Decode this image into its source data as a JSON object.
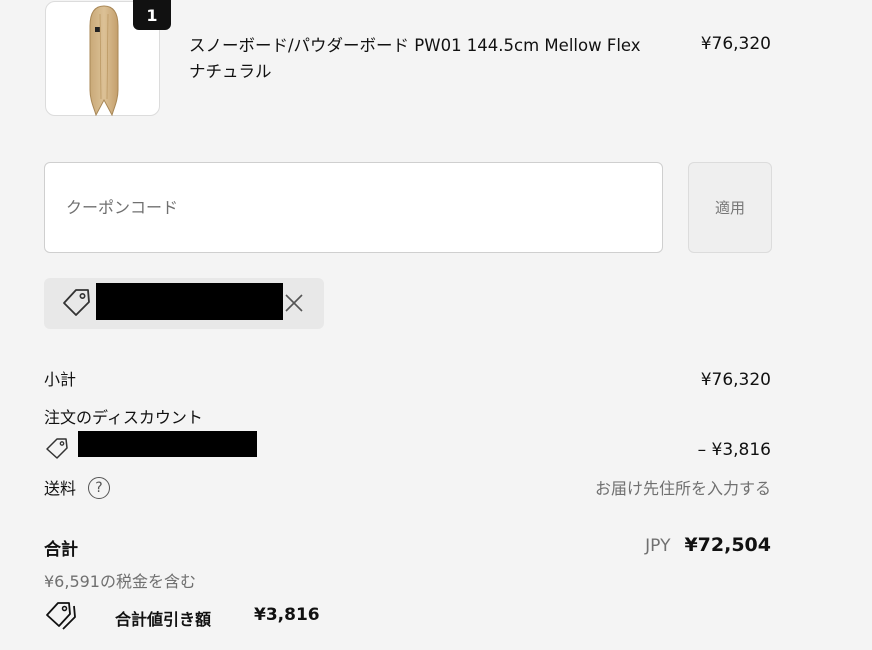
{
  "product": {
    "quantity": "1",
    "name_line1": "スノーボード/パウダーボード PW01 144.5cm Mellow Flex",
    "name_line2": "ナチュラル",
    "price": "¥76,320",
    "image_icon": "snowboard-icon"
  },
  "coupon": {
    "placeholder": "クーポンコード",
    "apply_label": "適用",
    "applied_icon": "tag-icon",
    "remove_icon": "close-icon"
  },
  "summary": {
    "subtotal_label": "小計",
    "subtotal_value": "¥76,320",
    "discount_label": "注文のディスカウント",
    "discount_value": "– ¥3,816",
    "shipping_label": "送料",
    "shipping_help": "?",
    "shipping_value": "お届け先住所を入力する",
    "total_label": "合計",
    "total_currency": "JPY",
    "total_value": "¥72,504",
    "tax_note": "¥6,591の税金を含む",
    "savings_label": "合計値引き額",
    "savings_value": "¥3,816"
  }
}
